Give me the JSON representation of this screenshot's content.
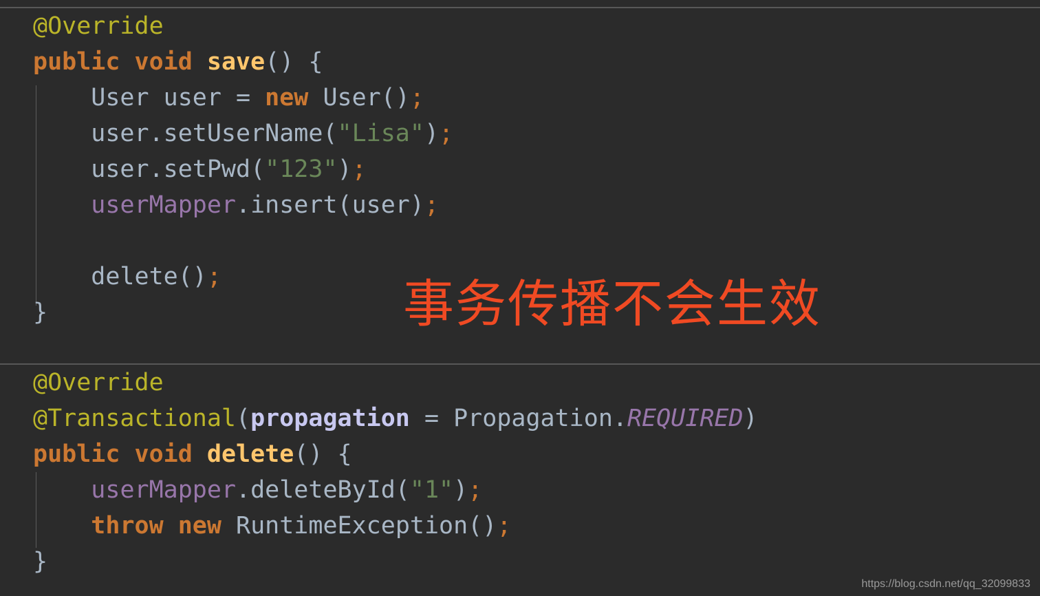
{
  "editor": {
    "background_color": "#2b2b2b",
    "default_text_color": "#a9b7c6",
    "separator_color": "#585858",
    "indent_guide_color": "#5c5c5c",
    "palette": {
      "annotation": "#bbb529",
      "keyword": "#cc7832",
      "method_name": "#ffc66d",
      "string": "#6a8759",
      "field": "#9876aa",
      "parameter": "#c8c8f0",
      "static_constant": "#9876aa",
      "plain": "#a9b7c6",
      "annotation_overlay": "#f04a23"
    }
  },
  "panes": [
    {
      "id": "save-method",
      "lines": [
        {
          "tokens": [
            {
              "text": "@Override",
              "type": "annotation"
            }
          ]
        },
        {
          "tokens": [
            {
              "text": "public",
              "type": "keyword"
            },
            {
              "text": " ",
              "type": "plain"
            },
            {
              "text": "void",
              "type": "keyword"
            },
            {
              "text": " ",
              "type": "plain"
            },
            {
              "text": "save",
              "type": "method"
            },
            {
              "text": "() {",
              "type": "plain"
            }
          ]
        },
        {
          "tokens": [
            {
              "text": "    User user = ",
              "type": "plain"
            },
            {
              "text": "new",
              "type": "keyword"
            },
            {
              "text": " User()",
              "type": "plain"
            },
            {
              "text": ";",
              "type": "semi"
            }
          ]
        },
        {
          "tokens": [
            {
              "text": "    user.setUserName(",
              "type": "plain"
            },
            {
              "text": "\"Lisa\"",
              "type": "string"
            },
            {
              "text": ")",
              "type": "plain"
            },
            {
              "text": ";",
              "type": "semi"
            }
          ]
        },
        {
          "tokens": [
            {
              "text": "    user.setPwd(",
              "type": "plain"
            },
            {
              "text": "\"123\"",
              "type": "string"
            },
            {
              "text": ")",
              "type": "plain"
            },
            {
              "text": ";",
              "type": "semi"
            }
          ]
        },
        {
          "tokens": [
            {
              "text": "    ",
              "type": "plain"
            },
            {
              "text": "userMapper",
              "type": "field"
            },
            {
              "text": ".insert(user)",
              "type": "plain"
            },
            {
              "text": ";",
              "type": "semi"
            }
          ]
        },
        {
          "tokens": [
            {
              "text": "",
              "type": "plain"
            }
          ]
        },
        {
          "tokens": [
            {
              "text": "    delete()",
              "type": "plain"
            },
            {
              "text": ";",
              "type": "semi"
            }
          ]
        },
        {
          "tokens": [
            {
              "text": "}",
              "type": "plain"
            }
          ]
        }
      ]
    },
    {
      "id": "delete-method",
      "lines": [
        {
          "tokens": [
            {
              "text": "@Override",
              "type": "annotation"
            }
          ]
        },
        {
          "tokens": [
            {
              "text": "@Transactional",
              "type": "annotation"
            },
            {
              "text": "(",
              "type": "plain"
            },
            {
              "text": "propagation",
              "type": "param"
            },
            {
              "text": " = Propagation.",
              "type": "plain"
            },
            {
              "text": "REQUIRED",
              "type": "static"
            },
            {
              "text": ")",
              "type": "plain"
            }
          ]
        },
        {
          "tokens": [
            {
              "text": "public",
              "type": "keyword"
            },
            {
              "text": " ",
              "type": "plain"
            },
            {
              "text": "void",
              "type": "keyword"
            },
            {
              "text": " ",
              "type": "plain"
            },
            {
              "text": "delete",
              "type": "method"
            },
            {
              "text": "() {",
              "type": "plain"
            }
          ]
        },
        {
          "tokens": [
            {
              "text": "    ",
              "type": "plain"
            },
            {
              "text": "userMapper",
              "type": "field"
            },
            {
              "text": ".deleteById(",
              "type": "plain"
            },
            {
              "text": "\"1\"",
              "type": "string"
            },
            {
              "text": ")",
              "type": "plain"
            },
            {
              "text": ";",
              "type": "semi"
            }
          ]
        },
        {
          "tokens": [
            {
              "text": "    ",
              "type": "plain"
            },
            {
              "text": "throw",
              "type": "keyword"
            },
            {
              "text": " ",
              "type": "plain"
            },
            {
              "text": "new",
              "type": "keyword"
            },
            {
              "text": " RuntimeException()",
              "type": "plain"
            },
            {
              "text": ";",
              "type": "semi"
            }
          ]
        },
        {
          "tokens": [
            {
              "text": "}",
              "type": "plain"
            }
          ]
        }
      ]
    }
  ],
  "overlay_note": {
    "text": "事务传播不会生效",
    "color": "#f04a23"
  },
  "watermark": {
    "text": "https://blog.csdn.net/qq_32099833"
  }
}
